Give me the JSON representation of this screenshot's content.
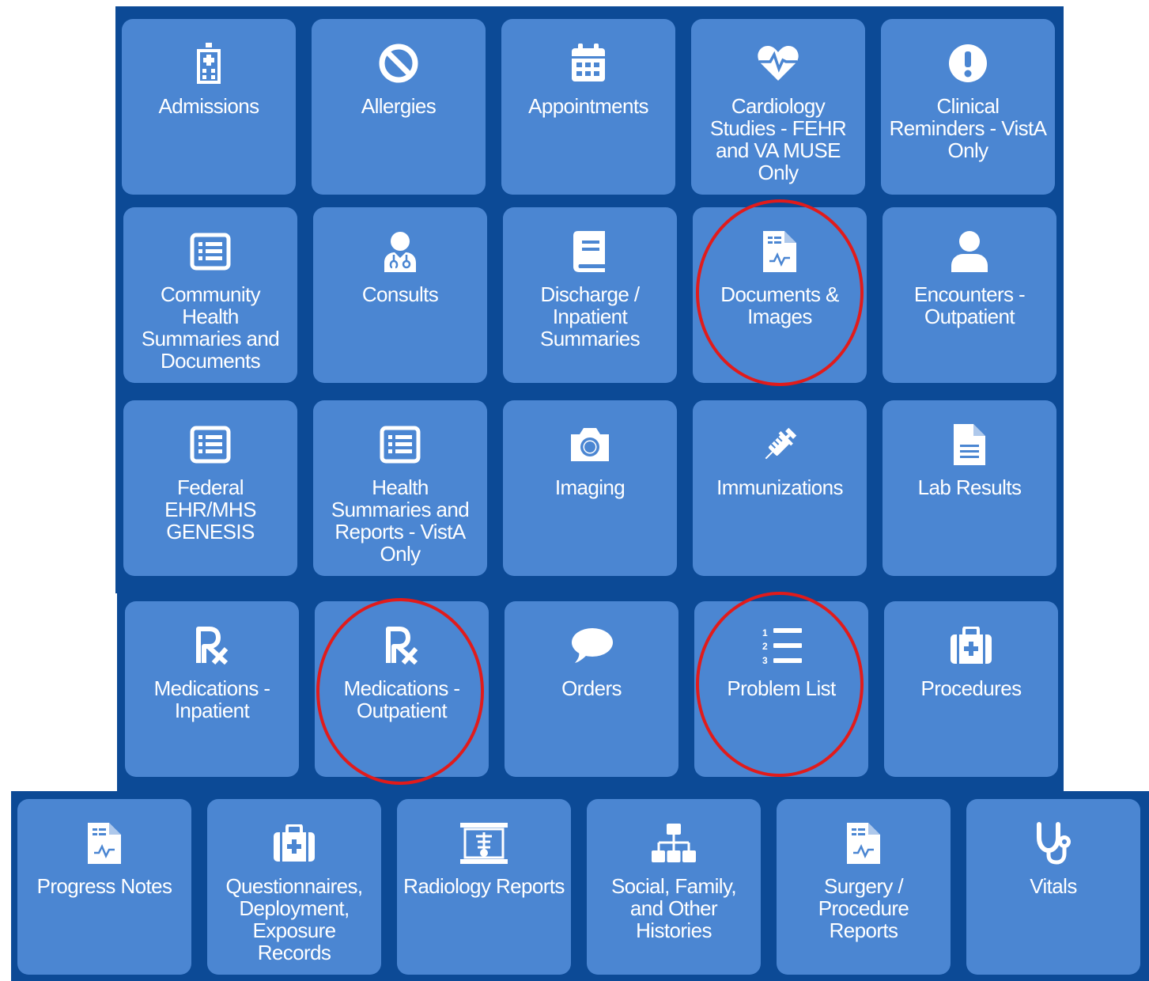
{
  "colors": {
    "panel": "#0c4a96",
    "tile": "#4b86d2",
    "text": "#ffffff",
    "highlight_ring": "#e11b1b"
  },
  "tiles": [
    {
      "label": "Admissions",
      "icon": "hospital-icon"
    },
    {
      "label": "Allergies",
      "icon": "prohibited-icon"
    },
    {
      "label": "Appointments",
      "icon": "calendar-icon"
    },
    {
      "label": "Cardiology Studies - FEHR and VA MUSE Only",
      "icon": "heartbeat-icon"
    },
    {
      "label": "Clinical Reminders - VistA Only",
      "icon": "exclamation-circle-icon"
    },
    {
      "label": "Community Health Summaries and Documents",
      "icon": "list-box-icon"
    },
    {
      "label": "Consults",
      "icon": "doctor-icon"
    },
    {
      "label": "Discharge / Inpatient Summaries",
      "icon": "book-icon"
    },
    {
      "label": "Documents & Images",
      "icon": "document-chart-icon",
      "highlighted": true
    },
    {
      "label": "Encounters - Outpatient",
      "icon": "user-icon"
    },
    {
      "label": "Federal EHR/MHS GENESIS",
      "icon": "list-box-icon"
    },
    {
      "label": "Health Summaries and Reports - VistA Only",
      "icon": "list-box-icon"
    },
    {
      "label": "Imaging",
      "icon": "camera-icon"
    },
    {
      "label": "Immunizations",
      "icon": "syringe-icon"
    },
    {
      "label": "Lab Results",
      "icon": "file-text-icon"
    },
    {
      "label": "Medications - Inpatient",
      "icon": "prescription-icon"
    },
    {
      "label": "Medications - Outpatient",
      "icon": "prescription-icon",
      "highlighted": true
    },
    {
      "label": "Orders",
      "icon": "comment-icon"
    },
    {
      "label": "Problem List",
      "icon": "numbered-list-icon",
      "highlighted": true
    },
    {
      "label": "Procedures",
      "icon": "medkit-icon"
    },
    {
      "label": "Progress Notes",
      "icon": "document-chart-icon"
    },
    {
      "label": "Questionnaires, Deployment, Exposure Records",
      "icon": "medkit-icon"
    },
    {
      "label": "Radiology Reports",
      "icon": "xray-icon"
    },
    {
      "label": "Social, Family, and Other Histories",
      "icon": "sitemap-icon"
    },
    {
      "label": "Surgery / Procedure Reports",
      "icon": "document-chart-icon"
    },
    {
      "label": "Vitals",
      "icon": "stethoscope-icon"
    }
  ]
}
